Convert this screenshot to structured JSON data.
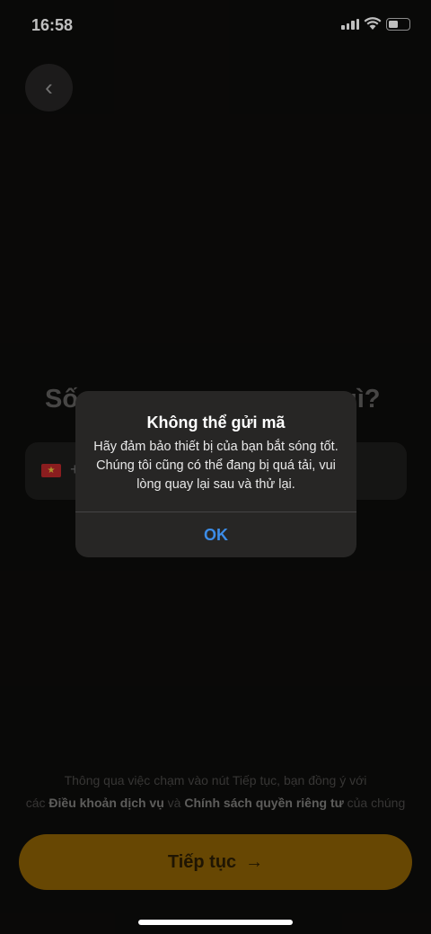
{
  "status_bar": {
    "time": "16:58"
  },
  "background": {
    "heading_start": "Số",
    "heading_end": "gì?",
    "phone_prefix": "+",
    "terms": {
      "line1": "Thông qua việc chạm vào nút Tiếp tục, bạn đồng ý với",
      "pre": "các ",
      "tos": "Điều khoản dịch vụ",
      "and": " và ",
      "privacy": "Chính sách quyền riêng tư",
      "post": " của chúng"
    },
    "continue_label": "Tiếp tục",
    "accent_color": "#8a5f05"
  },
  "dialog": {
    "title": "Không thể gửi mã",
    "message": "Hãy đảm bảo thiết bị của bạn bắt sóng tốt. Chúng tôi cũng có thể đang bị quá tải, vui lòng quay lại sau và thử lại.",
    "ok_label": "OK"
  }
}
